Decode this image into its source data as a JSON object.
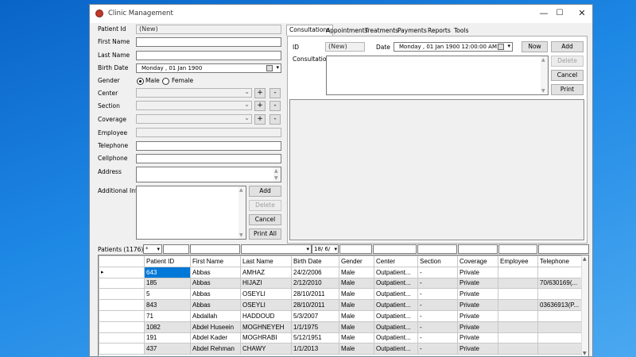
{
  "window": {
    "title": "Clinic Management",
    "min_glyph": "—",
    "max_glyph": "☐",
    "close_glyph": "✕"
  },
  "patient_form": {
    "patient_id_label": "Patient Id",
    "patient_id_value": "(New)",
    "first_name_label": "First Name",
    "last_name_label": "Last Name",
    "birth_date_label": "Birth Date",
    "birth_date_day": "Monday",
    "birth_date_value": ",  01 Jan  1900",
    "gender_label": "Gender",
    "gender_options": [
      "Male",
      "Female"
    ],
    "gender_selected": "Male",
    "center_label": "Center",
    "section_label": "Section",
    "coverage_label": "Coverage",
    "employee_label": "Employee",
    "telephone_label": "Telephone",
    "cellphone_label": "Cellphone",
    "address_label": "Address",
    "additional_info_label": "Additional Info",
    "plus": "+",
    "minus": "-",
    "buttons": {
      "add": "Add",
      "delete": "Delete",
      "cancel": "Cancel",
      "print_all": "Print All"
    }
  },
  "tabs": [
    "Consultations",
    "Appointments",
    "Treatments",
    "Payments",
    "Reports",
    "Tools"
  ],
  "active_tab": "Consultations",
  "consultation": {
    "id_label": "ID",
    "id_value": "(New)",
    "date_label": "Date",
    "date_day": "Monday",
    "date_value": ",  01 Jan  1900 12:00:00 AM",
    "consultation_label": "Consultation",
    "buttons": {
      "now": "Now",
      "add": "Add",
      "delete": "Delete",
      "cancel": "Cancel",
      "print": "Print"
    }
  },
  "patients_grid": {
    "label": "Patients (1176)",
    "filter_gender": "*",
    "filter_birthdate": "18/ 6/",
    "columns": [
      "Patient ID",
      "First Name",
      "Last Name",
      "Birth Date",
      "Gender",
      "Center",
      "Section",
      "Coverage",
      "Employee",
      "Telephone"
    ],
    "rows": [
      [
        "643",
        "Abbas",
        "AMHAZ",
        "24/2/2006",
        "Male",
        "Outpatient...",
        "-",
        "Private",
        "",
        ""
      ],
      [
        "185",
        "Abbas",
        "HIJAZI",
        "2/12/2010",
        "Male",
        "Outpatient...",
        "-",
        "Private",
        "",
        "70/630169(..."
      ],
      [
        "5",
        "Abbas",
        "OSEYLI",
        "28/10/2011",
        "Male",
        "Outpatient...",
        "-",
        "Private",
        "",
        ""
      ],
      [
        "843",
        "Abbas",
        "OSEYLI",
        "28/10/2011",
        "Male",
        "Outpatient...",
        "-",
        "Private",
        "",
        "03636913(P..."
      ],
      [
        "71",
        "Abdallah",
        "HADDOUD",
        "5/3/2007",
        "Male",
        "Outpatient...",
        "-",
        "Private",
        "",
        ""
      ],
      [
        "1082",
        "Abdel Huseein",
        "MOGHNEYEH",
        "1/1/1975",
        "Male",
        "Outpatient...",
        "-",
        "Private",
        "",
        ""
      ],
      [
        "191",
        "Abdel Kader",
        "MOGHRABI",
        "5/12/1951",
        "Male",
        "Outpatient...",
        "-",
        "Private",
        "",
        ""
      ],
      [
        "437",
        "Abdel Rehman",
        "CHAWY",
        "1/1/2013",
        "Male",
        "Outpatient...",
        "-",
        "Private",
        "",
        ""
      ]
    ]
  }
}
